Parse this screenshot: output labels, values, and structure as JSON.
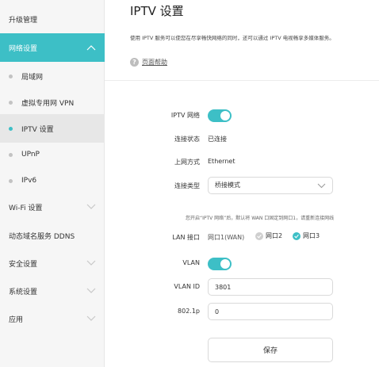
{
  "sidebar": {
    "items": [
      {
        "label": "升级管理"
      },
      {
        "label": "网络设置"
      },
      {
        "label": "局域网"
      },
      {
        "label": "虚拟专用网 VPN"
      },
      {
        "label": "IPTV 设置"
      },
      {
        "label": "UPnP"
      },
      {
        "label": "IPv6"
      },
      {
        "label": "Wi-Fi 设置"
      },
      {
        "label": "动态域名服务 DDNS"
      },
      {
        "label": "安全设置"
      },
      {
        "label": "系统设置"
      },
      {
        "label": "应用"
      }
    ]
  },
  "main": {
    "title": "IPTV 设置",
    "description": "使用 IPTV 服务可以使您在尽享畅快网络的同时，还可以通过 IPTV 电视畅享多媒体服务。",
    "help_link": "页面帮助",
    "help_icon_glyph": "?"
  },
  "form": {
    "iptv_label": "IPTV 网络",
    "iptv_enabled": true,
    "status_label": "连接状态",
    "status_value": "已连接",
    "internet_label": "上网方式",
    "internet_value": "Ethernet",
    "conn_type_label": "连接类型",
    "conn_type_value": "桥接模式",
    "notice": "您开启“IPTV 网络”后，默认将 WAN 口固定到网口1，请重新连接网线",
    "lan_label": "LAN 接口",
    "lan_wan": "网口1(WAN)",
    "lan_port2": "网口2",
    "lan_port3": "网口3",
    "vlan_label": "VLAN",
    "vlan_enabled": true,
    "vlan_id_label": "VLAN ID",
    "vlan_id_value": "3801",
    "p8021_label": "802.1p",
    "p8021_value": "0",
    "save_label": "保存"
  },
  "colors": {
    "accent": "#3dbfc6",
    "sidebar_bg": "#f6f6f6",
    "active_sub_bg": "#e7e7e7"
  }
}
